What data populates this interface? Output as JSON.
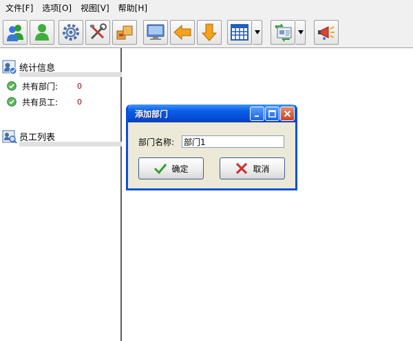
{
  "menu": [
    {
      "label": "文件[F]"
    },
    {
      "label": "选项[O]"
    },
    {
      "label": "视图[V]"
    },
    {
      "label": "帮助[H]"
    }
  ],
  "toolbar": {
    "icons": [
      "users-icon",
      "user-icon",
      "gear-icon",
      "tools-icon",
      "boxes-icon",
      "monitor-icon",
      "arrow-left-icon",
      "arrow-down-icon",
      "calendar-grid-icon",
      "card-swap-icon",
      "megaphone-icon"
    ]
  },
  "left_panel": {
    "stats": {
      "title": "统计信息",
      "items": [
        {
          "label": "共有部门:",
          "value": "0"
        },
        {
          "label": "共有员工:",
          "value": "0"
        }
      ]
    },
    "employees": {
      "title": "员工列表"
    }
  },
  "dialog": {
    "title": "添加部门",
    "field_label": "部门名称:",
    "field_value": "部门1",
    "ok_label": "确定",
    "cancel_label": "取消"
  },
  "colors": {
    "titlebar": "#0550dc",
    "dialog_bg": "#ece9d8",
    "stat_value": "#8b0000",
    "ok_green": "#2e9e2e",
    "cancel_red": "#d32f2f"
  }
}
